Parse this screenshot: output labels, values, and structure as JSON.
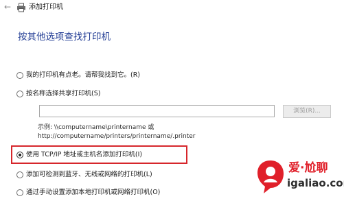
{
  "window": {
    "title": "添加打印机",
    "back_icon": "back-arrow-icon",
    "printer_icon": "printer-icon"
  },
  "heading": "按其他选项查找打印机",
  "options": [
    {
      "label": "我的打印机有点老。请帮我找到它。(R)",
      "checked": false
    },
    {
      "label": "按名称选择共享打印机(S)",
      "checked": false
    },
    {
      "label": "使用 TCP/IP 地址或主机名添加打印机(I)",
      "checked": true
    },
    {
      "label": "添加可检测到蓝牙、无线或网络的打印机(L)",
      "checked": false
    },
    {
      "label": "通过手动设置添加本地打印机或网络打印机(O)",
      "checked": false
    }
  ],
  "share": {
    "input_value": "",
    "browse_label": "浏览(R)..."
  },
  "example": {
    "line1": "示例: \\\\computername\\printername 或",
    "line2": "http://computername/printers/printername/.printer"
  },
  "watermark": {
    "title": "爱·尬聊",
    "domain": "igaliao.com"
  },
  "colors": {
    "heading": "#1f3a93",
    "highlight": "#d6262b",
    "watermark_red": "#e0202a"
  }
}
